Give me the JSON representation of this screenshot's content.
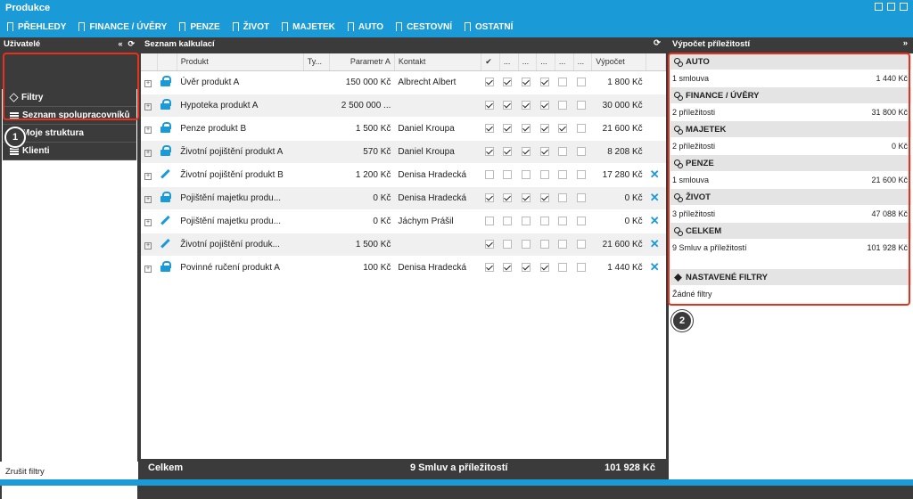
{
  "window": {
    "title": "Produkce"
  },
  "menu": [
    "PŘEHLEDY",
    "FINANCE / ÚVĚRY",
    "PENZE",
    "ŽIVOT",
    "MAJETEK",
    "AUTO",
    "CESTOVNÍ",
    "OSTATNÍ"
  ],
  "left": {
    "title": "Uživatelé",
    "items": [
      "Filtry",
      "Seznam spolupracovníků",
      "Moje struktura",
      "Klienti"
    ],
    "footer": "Zrušit filtry",
    "badge": "1"
  },
  "center": {
    "title": "Seznam kalkulací",
    "columns": [
      "Produkt",
      "Ty...",
      "Parametr A",
      "Kontakt",
      "✔",
      "...",
      "...",
      "...",
      "...",
      "...",
      "Výpočet"
    ],
    "rows": [
      {
        "icon": "lock-icon",
        "name": "Úvěr produkt A",
        "param": "150 000 Kč",
        "contact": "Albrecht Albert",
        "checks": [
          1,
          1,
          1,
          1,
          0,
          0
        ],
        "calc": "1 800 Kč",
        "del": false
      },
      {
        "icon": "lock-icon",
        "name": "Hypoteka produkt A",
        "param": "2 500 000 ...",
        "contact": "",
        "checks": [
          1,
          1,
          1,
          1,
          0,
          0
        ],
        "calc": "30 000 Kč",
        "del": false
      },
      {
        "icon": "lock-icon",
        "name": "Penze produkt B",
        "param": "1 500 Kč",
        "contact": "Daniel Kroupa",
        "checks": [
          1,
          1,
          1,
          1,
          1,
          0
        ],
        "calc": "21 600 Kč",
        "del": false
      },
      {
        "icon": "lock-icon",
        "name": "Životní pojištění produkt A",
        "param": "570 Kč",
        "contact": "Daniel Kroupa",
        "checks": [
          1,
          1,
          1,
          1,
          0,
          0
        ],
        "calc": "8 208 Kč",
        "del": false
      },
      {
        "icon": "pencil-icon",
        "name": "Životní pojištění produkt B",
        "param": "1 200 Kč",
        "contact": "Denisa Hradecká",
        "checks": [
          0,
          0,
          0,
          0,
          0,
          0
        ],
        "calc": "17 280 Kč",
        "del": true
      },
      {
        "icon": "lock-icon",
        "name": "Pojištění majetku produ...",
        "param": "0 Kč",
        "contact": "Denisa Hradecká",
        "checks": [
          1,
          1,
          1,
          1,
          0,
          0
        ],
        "calc": "0 Kč",
        "del": true
      },
      {
        "icon": "pencil-icon",
        "name": "Pojištění majetku produ...",
        "param": "0 Kč",
        "contact": "Jáchym Prášil",
        "checks": [
          0,
          0,
          0,
          0,
          0,
          0
        ],
        "calc": "0 Kč",
        "del": true
      },
      {
        "icon": "pencil-icon",
        "name": "Životní pojištění produk...",
        "param": "1 500 Kč",
        "contact": "",
        "checks": [
          1,
          0,
          0,
          0,
          0,
          0
        ],
        "calc": "21 600 Kč",
        "del": true
      },
      {
        "icon": "lock-icon",
        "name": "Povinné ručení produkt A",
        "param": "100 Kč",
        "contact": "Denisa Hradecká",
        "checks": [
          1,
          1,
          1,
          1,
          0,
          0
        ],
        "calc": "1 440 Kč",
        "del": true
      }
    ],
    "footer": {
      "label": "Celkem",
      "summary": "9 Smluv a příležitostí",
      "total": "101 928 Kč"
    }
  },
  "right": {
    "title": "Výpočet příležitostí",
    "sections": [
      {
        "name": "AUTO",
        "label": "1 smlouva",
        "value": "1 440 Kč"
      },
      {
        "name": "FINANCE / ÚVĚRY",
        "label": "2 příležitosti",
        "value": "31 800 Kč"
      },
      {
        "name": "MAJETEK",
        "label": "2 příležitosti",
        "value": "0 Kč"
      },
      {
        "name": "PENZE",
        "label": "1 smlouva",
        "value": "21 600 Kč"
      },
      {
        "name": "ŽIVOT",
        "label": "3 příležitosti",
        "value": "47 088 Kč"
      },
      {
        "name": "CELKEM",
        "label": "9 Smluv a příležitostí",
        "value": "101 928 Kč"
      }
    ],
    "filters": {
      "name": "NASTAVENÉ FILTRY",
      "label": "Žádné filtry"
    },
    "badge": "2"
  }
}
